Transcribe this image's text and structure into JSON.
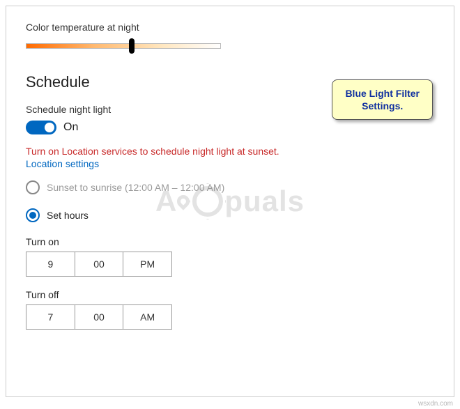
{
  "color_temp_label": "Color temperature at night",
  "slider_position_percent": 53,
  "schedule_heading": "Schedule",
  "schedule_toggle_label": "Schedule night light",
  "toggle_state_text": "On",
  "warning_text": "Turn on Location services to schedule night light at sunset.",
  "link_text": "Location settings",
  "radio_sunset_label": "Sunset to sunrise (12:00 AM – 12:00 AM)",
  "radio_sethours_label": "Set hours",
  "turn_on": {
    "label": "Turn on",
    "hour": "9",
    "minute": "00",
    "period": "PM"
  },
  "turn_off": {
    "label": "Turn off",
    "hour": "7",
    "minute": "00",
    "period": "AM"
  },
  "callout_line1": "Blue Light Filter",
  "callout_line2": "Settings.",
  "watermark_left": "A",
  "watermark_right": "puals",
  "credit": "wsxdn.com"
}
